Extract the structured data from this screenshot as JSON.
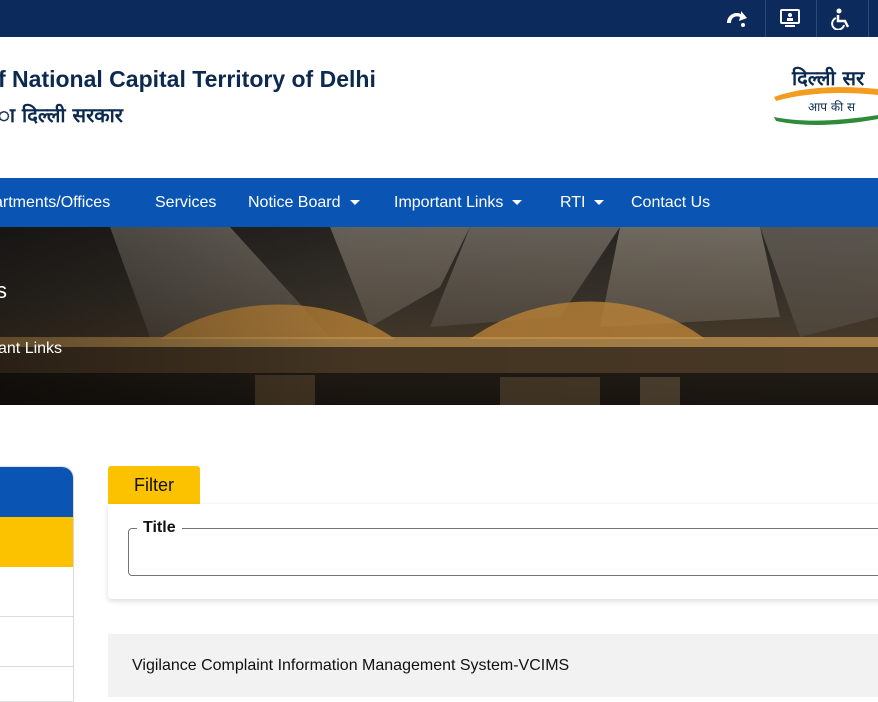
{
  "topbar": {
    "icons": [
      "skip-to-content-icon",
      "screen-reader-icon",
      "accessibility-icon"
    ]
  },
  "header": {
    "title_en": "f National Capital Territory of Delhi",
    "title_hi": "ा दिल्ली सरकार",
    "logo": {
      "line1": "दिल्ली सर",
      "line2": "आप की स",
      "colors": {
        "saffron": "#f39c1f",
        "green": "#2e8b3a",
        "text": "#0c2950"
      }
    }
  },
  "nav": {
    "items": [
      {
        "label": "artments/Offices",
        "has_caret": false
      },
      {
        "label": "Services",
        "has_caret": false
      },
      {
        "label": "Notice Board",
        "has_caret": true
      },
      {
        "label": "Important Links",
        "has_caret": true
      },
      {
        "label": "RTI",
        "has_caret": true
      },
      {
        "label": "Contact Us",
        "has_caret": false
      }
    ],
    "bg_color": "#0a54b4"
  },
  "banner": {
    "heading": "s",
    "breadcrumb": "ant Links"
  },
  "filter": {
    "tab_label": "Filter",
    "title_field": {
      "legend": "Title",
      "value": ""
    }
  },
  "results": [
    {
      "title": "Vigilance Complaint Information Management System-VCIMS"
    }
  ],
  "colors": {
    "navy": "#0d2a5c",
    "blue": "#0a54b4",
    "yellow": "#fcc200"
  }
}
